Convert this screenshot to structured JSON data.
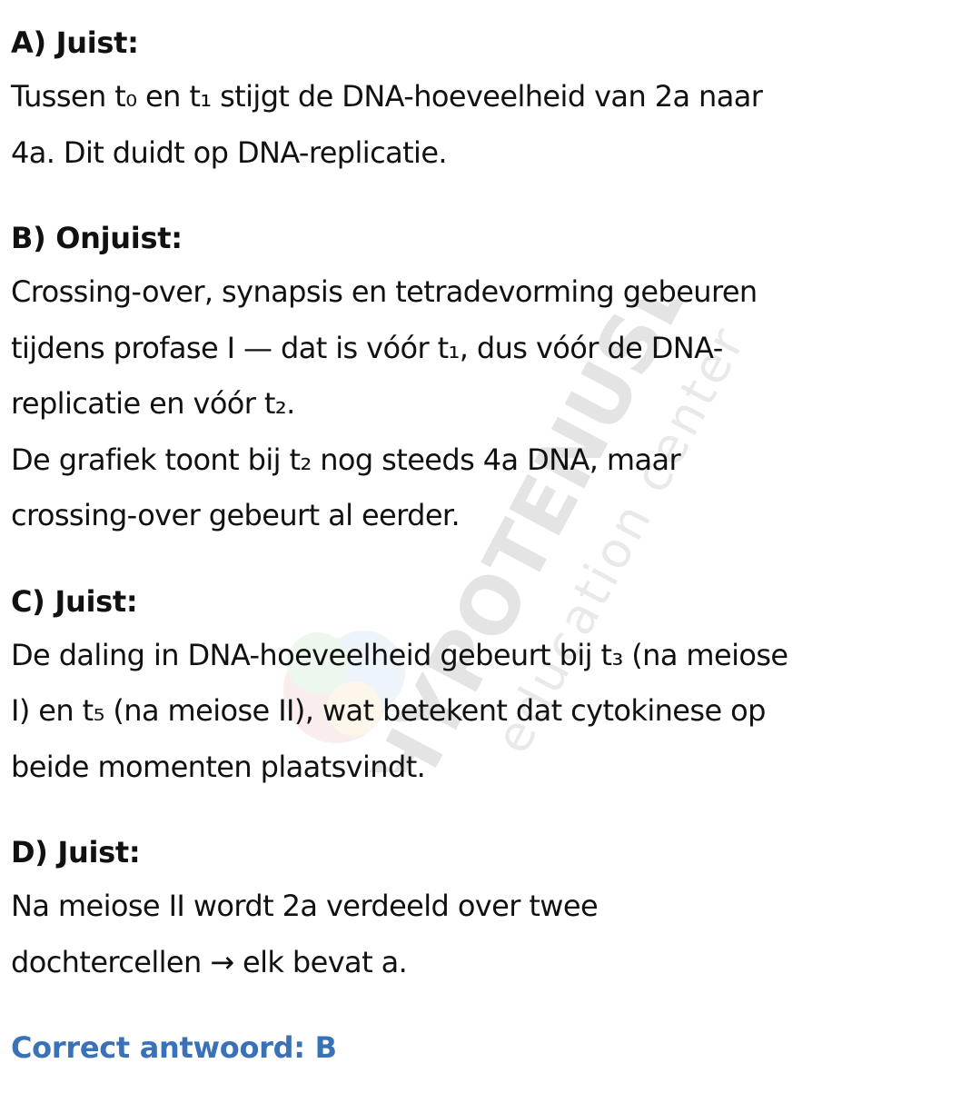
{
  "sections": [
    {
      "heading": "A) Juist:",
      "lines": [
        "Tussen t₀ en t₁ stijgt de DNA-hoeveelheid van 2a naar",
        "4a. Dit duidt op DNA-replicatie."
      ]
    },
    {
      "heading": "B) Onjuist:",
      "lines": [
        "Crossing-over, synapsis en tetradevorming gebeuren",
        "tijdens profase I — dat is vóór t₁, dus vóór de DNA-",
        "replicatie en vóór t₂.",
        "De grafiek toont bij t₂ nog steeds 4a DNA, maar",
        "crossing-over gebeurt al eerder."
      ]
    },
    {
      "heading": "C) Juist:",
      "lines": [
        "De daling in DNA-hoeveelheid gebeurt bij t₃ (na meiose",
        "I) en t₅ (na meiose II), wat betekent dat cytokinese op",
        "beide momenten plaatsvindt."
      ]
    },
    {
      "heading": "D) Juist:",
      "lines": [
        "Na meiose II wordt 2a verdeeld over twee",
        "dochtercellen → elk bevat a."
      ]
    }
  ],
  "answer": "Correct antwoord: B",
  "watermark": {
    "brand": "HYPOTENUSE",
    "tagline": "education center"
  },
  "colors": {
    "text": "#111111",
    "answer": "#3a72b8",
    "watermark": "#8a8a8a"
  }
}
